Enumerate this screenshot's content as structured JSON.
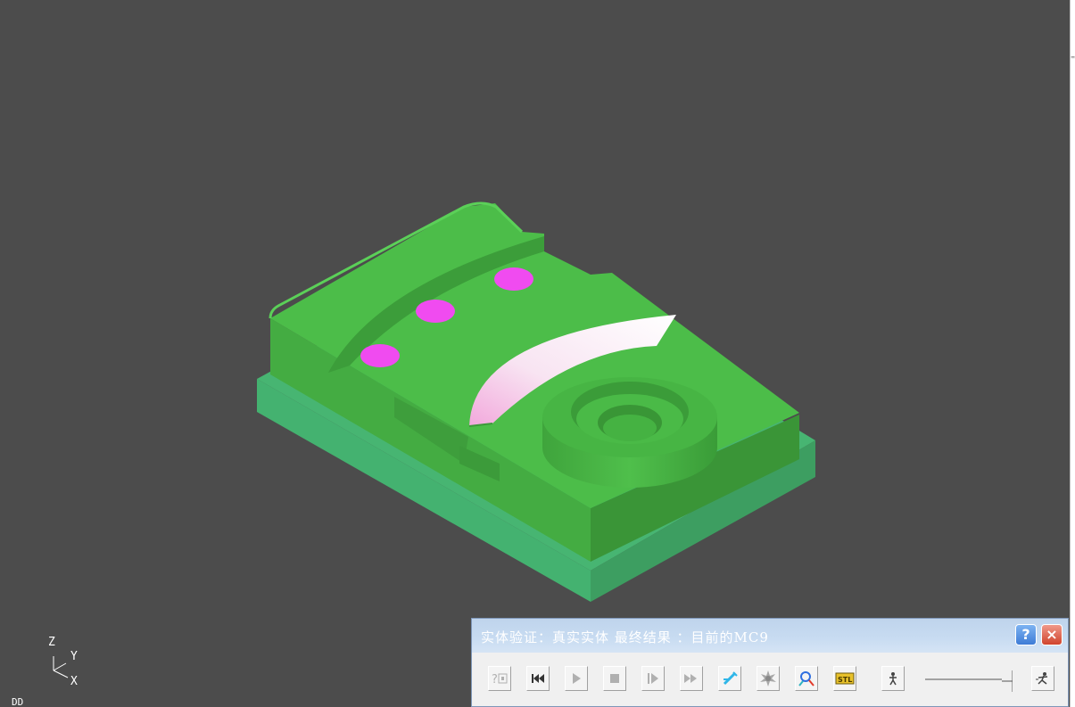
{
  "window": {
    "title": "实体验证：真实实体 最终结果 ：目前的MC9",
    "help_label": "?",
    "close_label": "×"
  },
  "toolbar": {
    "buttons": [
      {
        "name": "help-context-button",
        "icon": "help-context-icon"
      },
      {
        "name": "rewind-button",
        "icon": "rewind-icon"
      },
      {
        "name": "play-button",
        "icon": "play-icon"
      },
      {
        "name": "stop-button",
        "icon": "stop-icon"
      },
      {
        "name": "step-forward-button",
        "icon": "step-forward-icon"
      },
      {
        "name": "fast-forward-button",
        "icon": "fast-forward-icon"
      },
      {
        "name": "verify-tool-button",
        "icon": "tool-icon"
      },
      {
        "name": "collision-button",
        "icon": "collision-icon"
      },
      {
        "name": "zoom-button",
        "icon": "zoom-icon"
      },
      {
        "name": "stl-export-button",
        "icon": "stl-icon",
        "label": "STL"
      }
    ],
    "speed": {
      "slow_icon": "walk-icon",
      "fast_icon": "run-icon",
      "value": 1.0
    }
  },
  "axis_triad": {
    "z": "Z",
    "y": "Y",
    "x": "X"
  },
  "units_label": "DD",
  "colors": {
    "background": "#4c4c4c",
    "part": "#4cbd49",
    "base": "#47b572",
    "holes": "#f04bf0",
    "highlight": "#f4dcef"
  }
}
